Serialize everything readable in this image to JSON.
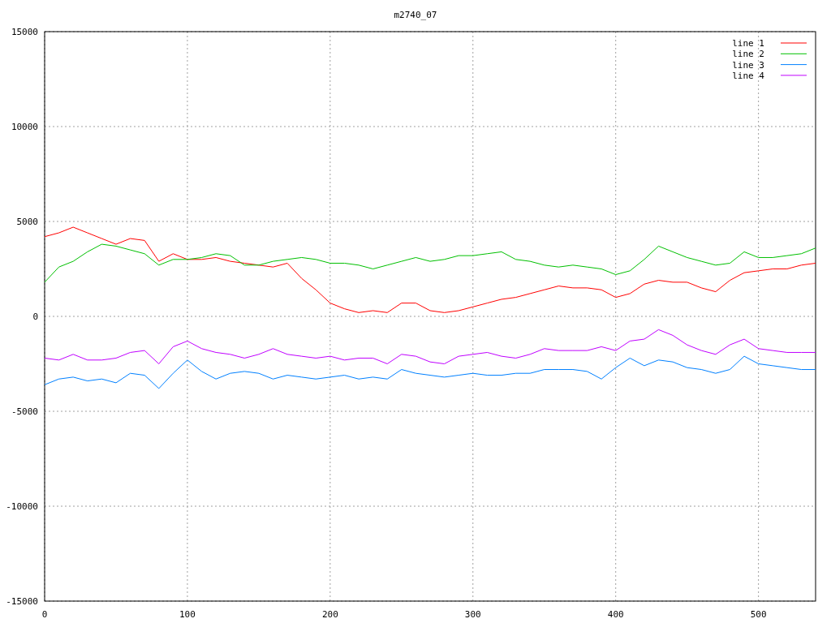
{
  "chart_data": {
    "type": "line",
    "title": "m2740_07",
    "x": [
      0,
      10,
      20,
      30,
      40,
      50,
      60,
      70,
      80,
      90,
      100,
      110,
      120,
      130,
      140,
      150,
      160,
      170,
      180,
      190,
      200,
      210,
      220,
      230,
      240,
      250,
      260,
      270,
      280,
      290,
      300,
      310,
      320,
      330,
      340,
      350,
      360,
      370,
      380,
      390,
      400,
      410,
      420,
      430,
      440,
      450,
      460,
      470,
      480,
      490,
      500,
      510,
      520,
      530,
      540
    ],
    "series": [
      {
        "name": "line 1",
        "color": "#ff0000",
        "values": [
          4200,
          4400,
          4700,
          4400,
          4100,
          3800,
          4100,
          4000,
          2900,
          3300,
          3000,
          3000,
          3100,
          2900,
          2800,
          2700,
          2600,
          2800,
          2000,
          1400,
          700,
          400,
          200,
          300,
          200,
          700,
          700,
          300,
          200,
          300,
          500,
          700,
          900,
          1000,
          1200,
          1400,
          1600,
          1500,
          1500,
          1400,
          1000,
          1200,
          1700,
          1900,
          1800,
          1800,
          1500,
          1300,
          1900,
          2300,
          2400,
          2500,
          2500,
          2700,
          2800
        ]
      },
      {
        "name": "line 2",
        "color": "#00c000",
        "values": [
          1800,
          2600,
          2900,
          3400,
          3800,
          3700,
          3500,
          3300,
          2700,
          3000,
          3000,
          3100,
          3300,
          3200,
          2700,
          2700,
          2900,
          3000,
          3100,
          3000,
          2800,
          2800,
          2700,
          2500,
          2700,
          2900,
          3100,
          2900,
          3000,
          3200,
          3200,
          3300,
          3400,
          3000,
          2900,
          2700,
          2600,
          2700,
          2600,
          2500,
          2200,
          2400,
          3000,
          3700,
          3400,
          3100,
          2900,
          2700,
          2800,
          3400,
          3100,
          3100,
          3200,
          3300,
          3600
        ]
      },
      {
        "name": "line 3",
        "color": "#0080ff",
        "values": [
          -3600,
          -3300,
          -3200,
          -3400,
          -3300,
          -3500,
          -3000,
          -3100,
          -3800,
          -3000,
          -2300,
          -2900,
          -3300,
          -3000,
          -2900,
          -3000,
          -3300,
          -3100,
          -3200,
          -3300,
          -3200,
          -3100,
          -3300,
          -3200,
          -3300,
          -2800,
          -3000,
          -3100,
          -3200,
          -3100,
          -3000,
          -3100,
          -3100,
          -3000,
          -3000,
          -2800,
          -2800,
          -2800,
          -2900,
          -3300,
          -2700,
          -2200,
          -2600,
          -2300,
          -2400,
          -2700,
          -2800,
          -3000,
          -2800,
          -2100,
          -2500,
          -2600,
          -2700,
          -2800,
          -2800
        ]
      },
      {
        "name": "line 4",
        "color": "#c000ff",
        "values": [
          -2200,
          -2300,
          -2000,
          -2300,
          -2300,
          -2200,
          -1900,
          -1800,
          -2500,
          -1600,
          -1300,
          -1700,
          -1900,
          -2000,
          -2200,
          -2000,
          -1700,
          -2000,
          -2100,
          -2200,
          -2100,
          -2300,
          -2200,
          -2200,
          -2500,
          -2000,
          -2100,
          -2400,
          -2500,
          -2100,
          -2000,
          -1900,
          -2100,
          -2200,
          -2000,
          -1700,
          -1800,
          -1800,
          -1800,
          -1600,
          -1800,
          -1300,
          -1200,
          -700,
          -1000,
          -1500,
          -1800,
          -2000,
          -1500,
          -1200,
          -1700,
          -1800,
          -1900,
          -1900,
          -1900
        ]
      }
    ],
    "xlim": [
      0,
      540
    ],
    "ylim": [
      -15000,
      15000
    ],
    "xticks": [
      0,
      100,
      200,
      300,
      400,
      500
    ],
    "yticks": [
      -15000,
      -10000,
      -5000,
      0,
      5000,
      10000,
      15000
    ],
    "grid": true,
    "legend": true
  }
}
